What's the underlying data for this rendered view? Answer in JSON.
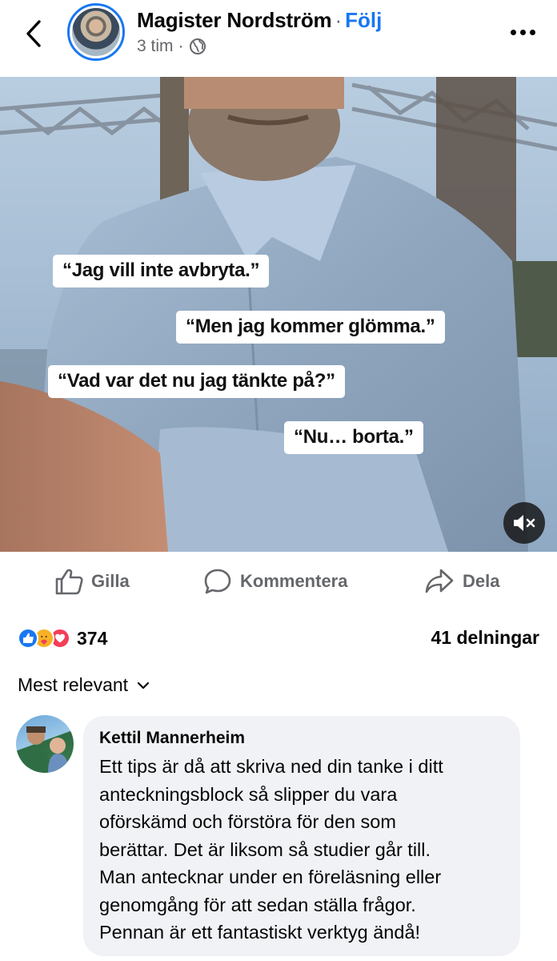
{
  "header": {
    "author_name": "Magister Nordström",
    "separator": "·",
    "follow_label": "Följ",
    "time": "3 tim",
    "meta_separator": "·",
    "privacy_icon": "globe-icon"
  },
  "video": {
    "captions": [
      "“Jag vill inte avbryta.”",
      "“Men jag kommer glömma.”",
      "“Vad var det nu jag tänkte på?”",
      "“Nu… borta.”"
    ],
    "mute_icon": "speaker-muted-icon"
  },
  "actions": {
    "like_label": "Gilla",
    "comment_label": "Kommentera",
    "share_label": "Dela"
  },
  "stats": {
    "reaction_icons": [
      "like-reaction-icon",
      "care-reaction-icon",
      "love-reaction-icon"
    ],
    "reaction_count": "374",
    "shares": "41 delningar"
  },
  "sort": {
    "label": "Mest relevant"
  },
  "comment": {
    "author": "Kettil Mannerheim",
    "lines": [
      "Ett tips är då att skriva ned din tanke i ditt",
      "anteckningsblock så slipper du vara",
      "oförskämd och förstöra för den som",
      "berättar. Det är liksom så studier går till.",
      "Man antecknar under en föreläsning eller",
      "genomgång för att sedan ställa frågor.",
      "Pennan är ett fantastiskt verktyg ändå!"
    ]
  },
  "colors": {
    "accent": "#1877f2",
    "secondary_text": "#65676b",
    "comment_bg": "#f0f2f5",
    "love": "#f33e58",
    "care": "#f7b125"
  }
}
